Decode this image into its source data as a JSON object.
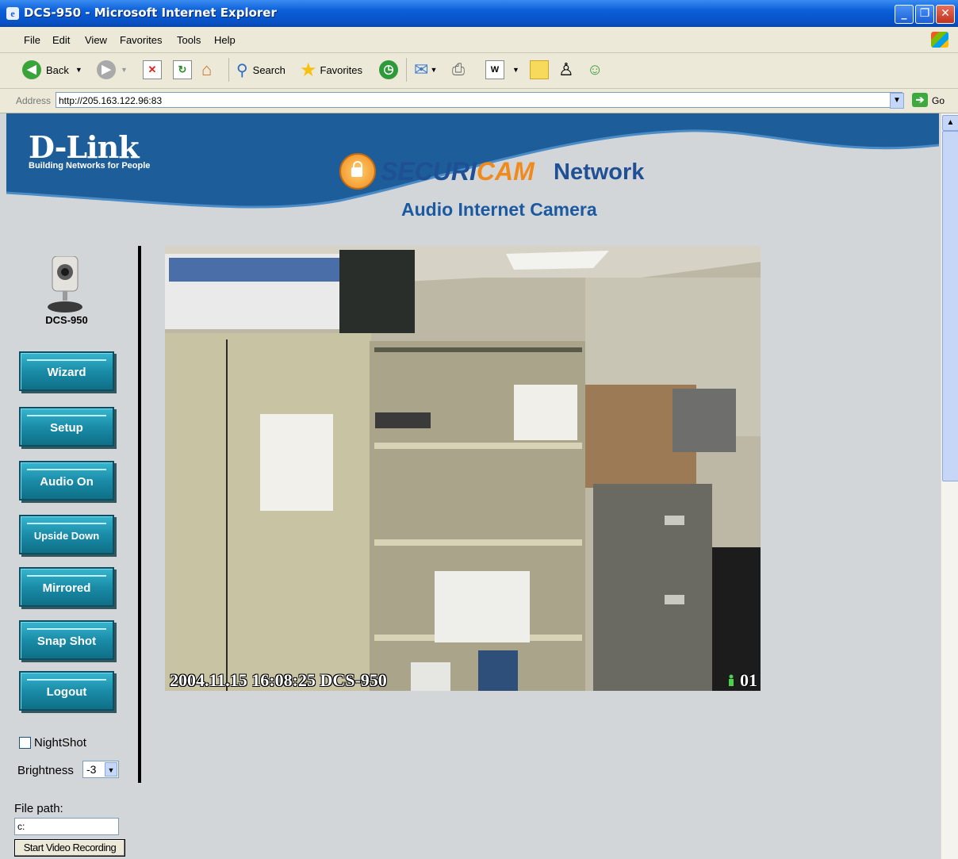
{
  "window": {
    "title": "DCS-950 - Microsoft Internet Explorer",
    "minimize": "_",
    "restore": "❐",
    "close": "✕"
  },
  "menu": [
    "File",
    "Edit",
    "View",
    "Favorites",
    "Tools",
    "Help"
  ],
  "toolbar": {
    "back": "Back",
    "search": "Search",
    "favorites": "Favorites"
  },
  "address": {
    "label": "Address",
    "url": "http://205.163.122.96:83",
    "go": "Go"
  },
  "brand": {
    "logo": "D-Link",
    "tagline": "Building Networks for People",
    "product_a": "SECURI",
    "product_b": "CAM",
    "product_c": "Network",
    "subtitle": "Audio Internet Camera"
  },
  "camera": {
    "model": "DCS-950"
  },
  "sidebar": {
    "buttons": [
      "Wizard",
      "Setup",
      "Audio On",
      "Upside Down",
      "Mirrored",
      "Snap Shot",
      "Logout"
    ],
    "nightshot": "NightShot",
    "nightshot_checked": false,
    "brightness_label": "Brightness",
    "brightness_value": "-3",
    "filepath_label": "File path:",
    "filepath_value": "c:",
    "record_button": "Start Video Recording"
  },
  "video": {
    "overlay_text": "2004.11.15 16:08:25 DCS-950",
    "user_count": "01"
  },
  "colors": {
    "banner": "#1d5e9a",
    "button": "#1a8ca8",
    "page_bg": "#d3d6d9"
  }
}
